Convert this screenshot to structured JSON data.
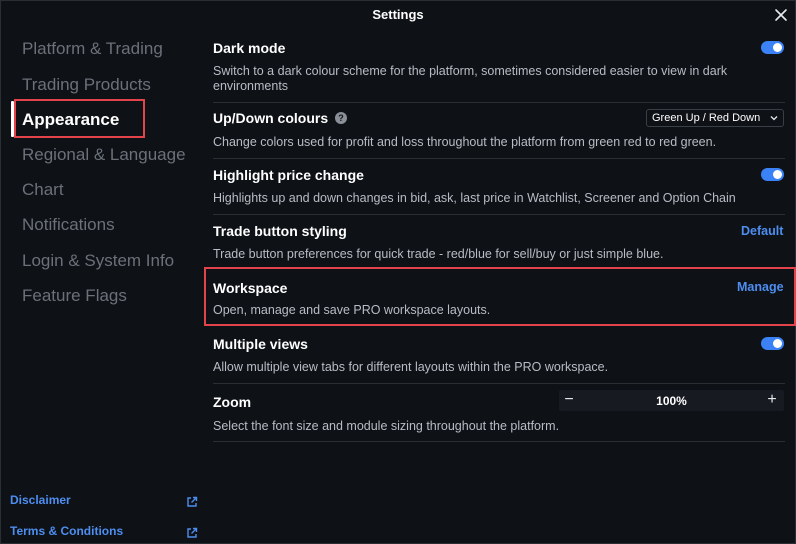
{
  "window": {
    "title": "Settings"
  },
  "sidebar": {
    "items": [
      {
        "label": "Platform & Trading"
      },
      {
        "label": "Trading Products"
      },
      {
        "label": "Appearance"
      },
      {
        "label": "Regional & Language"
      },
      {
        "label": "Chart"
      },
      {
        "label": "Notifications"
      },
      {
        "label": "Login & System Info"
      },
      {
        "label": "Feature Flags"
      }
    ],
    "active": "Appearance",
    "footer": [
      {
        "label": "Disclaimer",
        "icon": "external-link-icon"
      },
      {
        "label": "Terms & Conditions",
        "icon": "external-link-icon"
      }
    ]
  },
  "settings": {
    "dark_mode": {
      "title": "Dark mode",
      "description": "Switch to a dark colour scheme for the platform, sometimes considered easier to view in dark environments",
      "enabled": true
    },
    "updown_colours": {
      "title": "Up/Down colours",
      "description": "Change colors used for profit and loss throughout the platform from green red to red green.",
      "selected": "Green Up / Red Down",
      "help_icon": "?"
    },
    "highlight_price_change": {
      "title": "Highlight price change",
      "description": "Highlights up and down changes in bid, ask, last price in Watchlist, Screener and Option Chain",
      "enabled": true
    },
    "trade_button_styling": {
      "title": "Trade button styling",
      "description": "Trade button preferences for quick trade - red/blue for sell/buy or just simple blue.",
      "action": "Default"
    },
    "workspace": {
      "title": "Workspace",
      "description": "Open, manage and save PRO workspace layouts.",
      "action": "Manage"
    },
    "multiple_views": {
      "title": "Multiple views",
      "description": "Allow multiple view tabs for different layouts within the PRO workspace.",
      "enabled": true
    },
    "zoom": {
      "title": "Zoom",
      "description": "Select the font size and module sizing throughout the platform.",
      "value": "100%",
      "decrement": "−",
      "increment": "+"
    }
  },
  "colors": {
    "accent": "#3b82f6",
    "link": "#4d8ef0",
    "highlight_border": "#e3434b",
    "background": "#0e1116"
  }
}
